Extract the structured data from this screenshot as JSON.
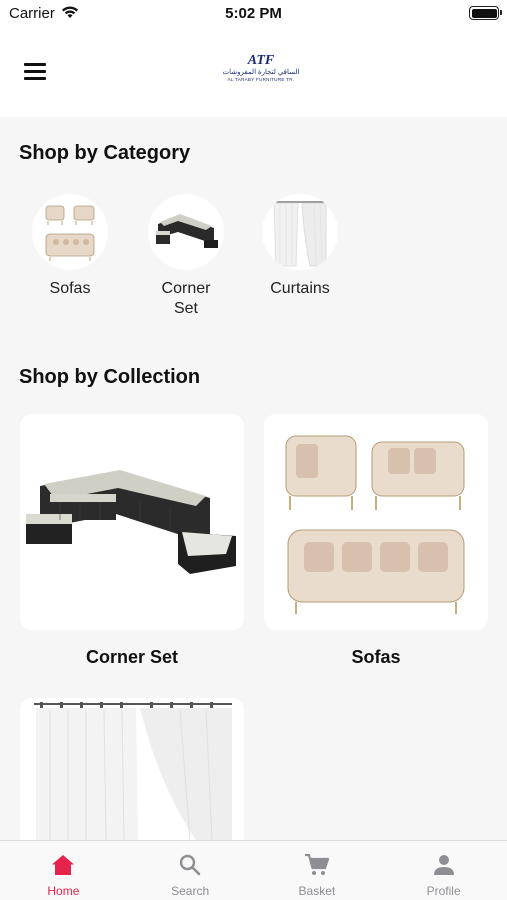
{
  "status": {
    "carrier": "Carrier",
    "time": "5:02 PM"
  },
  "header": {
    "logo_mark": "ATF",
    "logo_ar": "الساقي لتجارة المفروشات",
    "logo_en": "AL TARABY FURNITURE TR."
  },
  "categories": {
    "title": "Shop by Category",
    "items": [
      {
        "label": "Sofas",
        "icon": "sofa-icon"
      },
      {
        "label": "Corner\nSet",
        "icon": "corner-set-icon"
      },
      {
        "label": "Curtains",
        "icon": "curtain-icon"
      }
    ]
  },
  "collections": {
    "title": "Shop by Collection",
    "items": [
      {
        "label": "Corner Set"
      },
      {
        "label": "Sofas"
      },
      {
        "label": ""
      }
    ]
  },
  "tabs": [
    {
      "label": "Home",
      "icon": "home-icon",
      "active": true
    },
    {
      "label": "Search",
      "icon": "search-icon",
      "active": false
    },
    {
      "label": "Basket",
      "icon": "cart-icon",
      "active": false
    },
    {
      "label": "Profile",
      "icon": "profile-icon",
      "active": false
    }
  ],
  "colors": {
    "accent": "#e5234c",
    "inactive": "#8e8e93",
    "brand": "#1c2a78"
  }
}
